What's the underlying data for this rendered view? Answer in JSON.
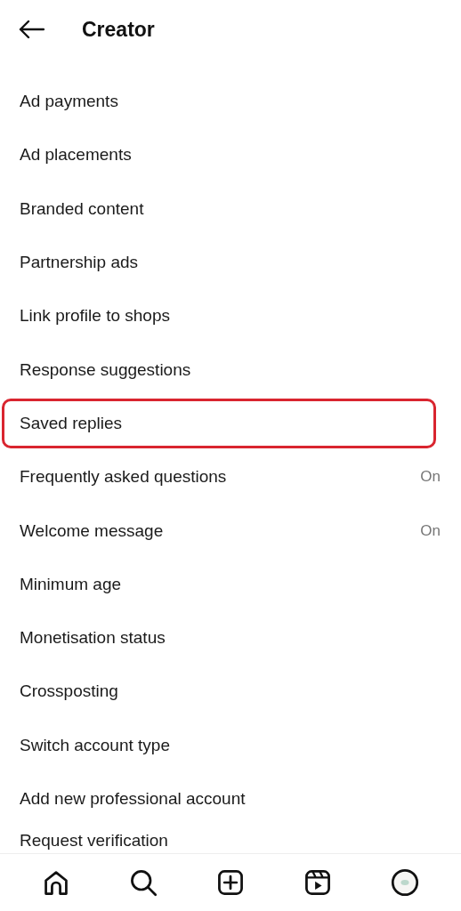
{
  "header": {
    "title": "Creator"
  },
  "items": [
    {
      "label": "Ad payments",
      "highlighted": false
    },
    {
      "label": "Ad placements",
      "highlighted": false
    },
    {
      "label": "Branded content",
      "highlighted": false
    },
    {
      "label": "Partnership ads",
      "highlighted": false
    },
    {
      "label": "Link profile to shops",
      "highlighted": false
    },
    {
      "label": "Response suggestions",
      "highlighted": false
    },
    {
      "label": "Saved replies",
      "highlighted": true
    },
    {
      "label": "Frequently asked questions",
      "highlighted": false,
      "value": "On"
    },
    {
      "label": "Welcome message",
      "highlighted": false,
      "value": "On"
    },
    {
      "label": "Minimum age",
      "highlighted": false
    },
    {
      "label": "Monetisation status",
      "highlighted": false
    },
    {
      "label": "Crossposting",
      "highlighted": false
    },
    {
      "label": "Switch account type",
      "highlighted": false
    },
    {
      "label": "Add new professional account",
      "highlighted": false
    },
    {
      "label": "Request verification",
      "highlighted": false
    }
  ],
  "bottom_nav": [
    {
      "kind": "home"
    },
    {
      "kind": "search"
    },
    {
      "kind": "create"
    },
    {
      "kind": "reels"
    },
    {
      "kind": "profile"
    }
  ]
}
